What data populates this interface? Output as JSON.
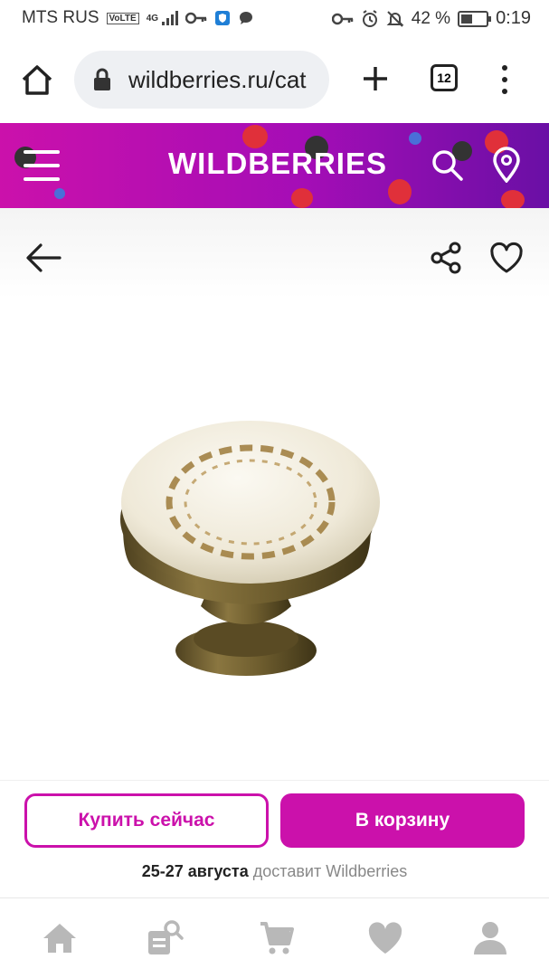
{
  "status_bar": {
    "carrier": "MTS RUS",
    "volte": "VoLTE",
    "network": "4G",
    "battery_text": "42 %",
    "time": "0:19"
  },
  "browser": {
    "url": "wildberries.ru/cat",
    "tab_count": "12"
  },
  "header": {
    "logo": "WILDBERRIES",
    "brand_color": "#cb11ab"
  },
  "product": {
    "image_alt": "ceramic knob with antique bronze base"
  },
  "actions": {
    "buy_now_label": "Купить сейчас",
    "add_to_cart_label": "В корзину",
    "delivery_dates": "25-27 августа",
    "delivery_text": "доставит Wildberries"
  },
  "bottom_nav": {
    "items": [
      "home-icon",
      "catalog-search-icon",
      "cart-icon",
      "favorites-icon",
      "profile-icon"
    ]
  }
}
